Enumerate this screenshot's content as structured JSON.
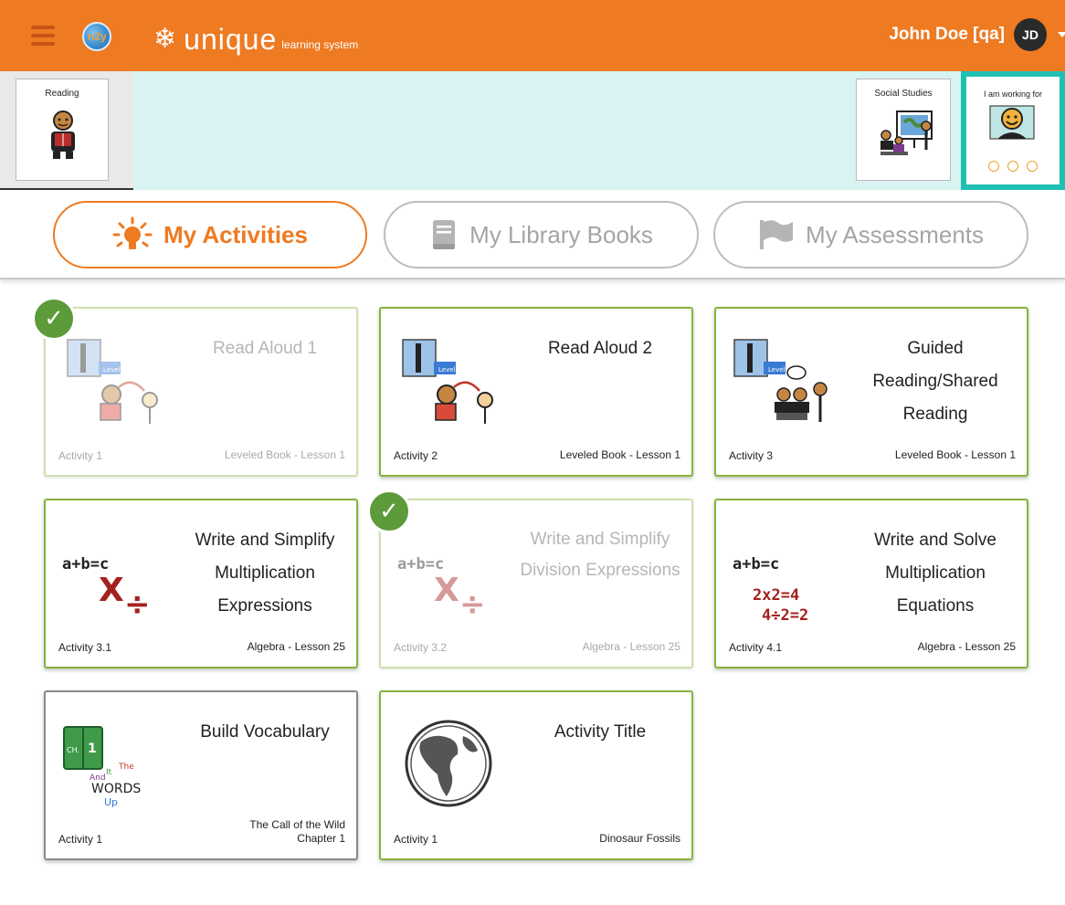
{
  "header": {
    "logo_text": "n2y",
    "brand_main": "unique",
    "brand_sub": "learning system",
    "user_name": "John Doe [qa]",
    "user_initials": "JD"
  },
  "subjects": {
    "reading": "Reading",
    "social_studies": "Social Studies",
    "working_for": "I am working for"
  },
  "tabs": [
    {
      "label": "My Activities",
      "active": true
    },
    {
      "label": "My Library Books",
      "active": false
    },
    {
      "label": "My Assessments",
      "active": false
    }
  ],
  "cards": [
    {
      "title": "Read Aloud 1",
      "activity": "Activity 1",
      "lesson": "Leveled Book - Lesson 1",
      "completed": true,
      "icon": "read-aloud-icon"
    },
    {
      "title": "Read Aloud 2",
      "activity": "Activity 2",
      "lesson": "Leveled Book - Lesson 1",
      "completed": false,
      "icon": "read-aloud-icon"
    },
    {
      "title": "Guided Reading/Shared Reading",
      "activity": "Activity 3",
      "lesson": "Leveled Book - Lesson 1",
      "completed": false,
      "icon": "guided-reading-icon"
    },
    {
      "title": "Write and Simplify Multiplication Expressions",
      "activity": "Activity 3.1",
      "lesson": "Algebra - Lesson 25",
      "completed": false,
      "icon": "math-expression-icon"
    },
    {
      "title": "Write and Simplify Division Expressions",
      "activity": "Activity 3.2",
      "lesson": "Algebra - Lesson 25",
      "completed": true,
      "icon": "math-expression-icon"
    },
    {
      "title": "Write and Solve Multiplication Equations",
      "activity": "Activity 4.1",
      "lesson": "Algebra - Lesson 25",
      "completed": false,
      "icon": "math-equation-icon"
    },
    {
      "title": "Build Vocabulary",
      "activity": "Activity 1",
      "lesson_line1": "The Call of the Wild",
      "lesson_line2": "Chapter 1",
      "completed": false,
      "icon": "vocabulary-book-icon"
    },
    {
      "title": "Activity Title",
      "activity": "Activity 1",
      "lesson": "Dinosaur Fossils",
      "completed": false,
      "icon": "globe-icon"
    }
  ],
  "art_text": {
    "level": "Level",
    "eq": "a+b=c",
    "times": "X",
    "divide": "÷",
    "eq1": "2x2=4",
    "eq2": "4÷2=2",
    "vocab_ch": "CH.",
    "vocab_num": "1",
    "vocab_words": [
      "And",
      "It",
      "The",
      "WORDS",
      "Up"
    ]
  },
  "colors": {
    "header": "#ee7a22",
    "strip": "#d9f3f3",
    "card_border": "#86b33a",
    "check": "#5c9a3a",
    "math_red": "#a3221f",
    "working_border": "#1fc0b3"
  }
}
